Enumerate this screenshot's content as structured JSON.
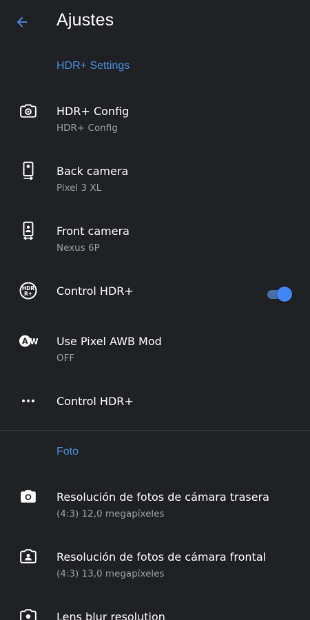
{
  "appbar": {
    "title": "Ajustes",
    "back_icon": "arrow-back-icon"
  },
  "colors": {
    "background": "#202124",
    "accent": "#4285f4",
    "section_header": "#4a90e2",
    "summary_text": "#9aa0a6"
  },
  "sections": [
    {
      "header": "HDR+ Settings",
      "items": [
        {
          "title": "HDR+ Config",
          "summary": "HDR+ Config",
          "icon": "camera-settings-icon"
        },
        {
          "title": "Back camera",
          "summary": "Pixel 3 XL",
          "icon": "phone-rear-camera-icon"
        },
        {
          "title": "Front camera",
          "summary": "Nexus 6P",
          "icon": "phone-front-camera-icon"
        },
        {
          "title": "Control HDR+",
          "summary": "",
          "icon": "hdr-plus-icon",
          "switch_on": true
        },
        {
          "title": "Use Pixel AWB Mod",
          "summary": "OFF",
          "icon": "awb-icon"
        },
        {
          "title": "Control HDR+",
          "summary": "",
          "icon": "more-horiz-icon"
        }
      ]
    },
    {
      "header": "Foto",
      "items": [
        {
          "title": "Resolución de fotos de cámara trasera",
          "summary": "(4:3) 12,0 megapíxeles",
          "icon": "rear-camera-icon"
        },
        {
          "title": "Resolución de fotos de cámara frontal",
          "summary": "(4:3) 13,0 megapíxeles",
          "icon": "front-camera-icon"
        },
        {
          "title": "Lens blur resolution",
          "summary": "",
          "icon": "lens-blur-icon"
        }
      ]
    }
  ]
}
